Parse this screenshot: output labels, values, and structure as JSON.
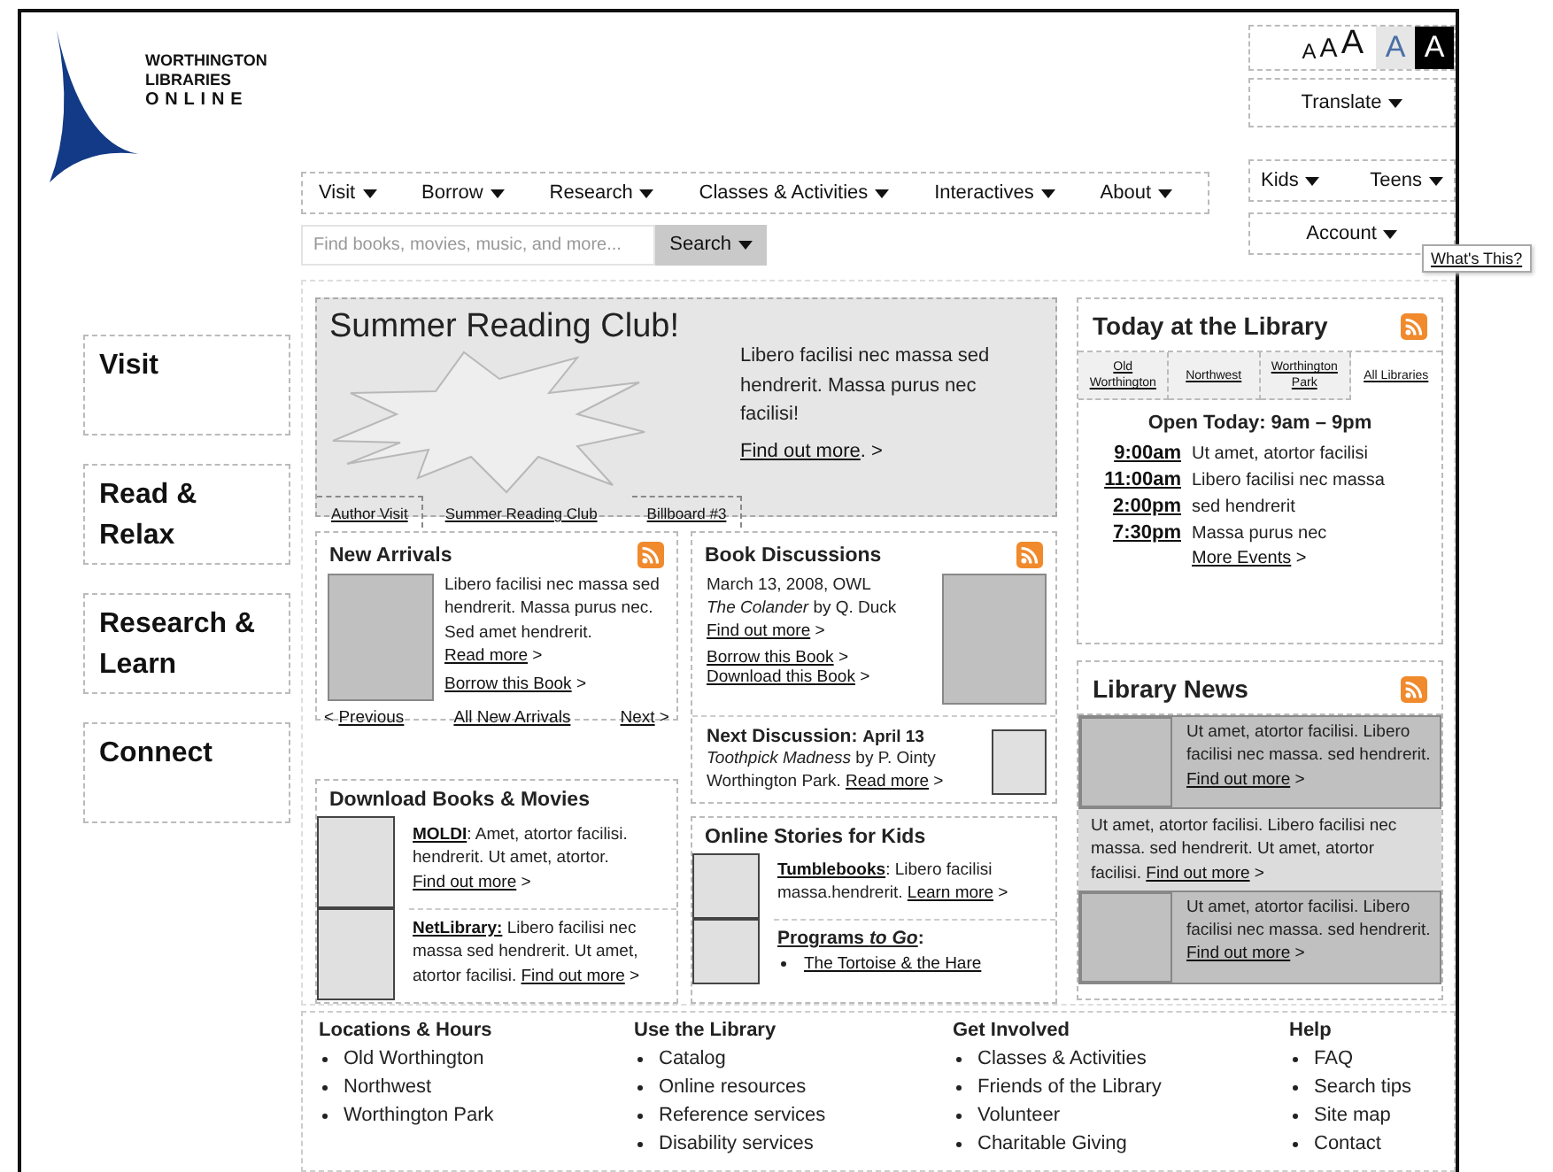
{
  "logo": {
    "lines": [
      "WORTHINGTON",
      "LIBRARIES",
      "ONLINE"
    ]
  },
  "text_size_options": [
    {
      "label": "A",
      "kind": "small"
    },
    {
      "label": "A",
      "kind": "medium"
    },
    {
      "label": "A",
      "kind": "large"
    }
  ],
  "contrast_options": [
    {
      "label": "A",
      "kind": "light"
    },
    {
      "label": "A",
      "kind": "dark"
    }
  ],
  "translate": "Translate",
  "main_nav": [
    "Visit",
    "Borrow",
    "Research",
    "Classes & Activities",
    "Interactives",
    "About"
  ],
  "audience_nav": [
    "Kids",
    "Teens"
  ],
  "search": {
    "placeholder": "Find books, movies, music, and more...",
    "button": "Search"
  },
  "account": "Account",
  "tooltip": "What's This?",
  "side_nav": [
    "Visit",
    "Read & Relax",
    "Research & Learn",
    "Connect"
  ],
  "feature": {
    "title": "Summer Reading Club!",
    "text": "Libero facilisi nec massa sed hendrerit.  Massa purus nec facilisi!",
    "link": "Find out more",
    "suffix": ". >",
    "tabs": [
      {
        "label": "Author Visit",
        "selected": false
      },
      {
        "label": "Summer Reading Club",
        "selected": true
      },
      {
        "label": "Billboard #3",
        "selected": false
      }
    ]
  },
  "new_arrivals": {
    "title": "New Arrivals",
    "text": "Libero facilisi nec massa sed hendrerit. Massa purus nec. Sed amet hendrerit.",
    "link": "Read more",
    "suffix": " >",
    "action": "Borrow this Book",
    "action_suffix": " >",
    "previous_prefix": "< ",
    "previous": "Previous",
    "all": "All New Arrivals",
    "next": "Next",
    "next_suffix": " >"
  },
  "downloads": {
    "title": "Download Books & Movies",
    "items": [
      {
        "name": "MOLDI",
        "text": ": Amet, atortor facilisi. hendrerit. Ut amet, atortor.",
        "link": "Find out more",
        "suffix": " >"
      },
      {
        "name": "NetLibrary:",
        "text": " Libero facilisi nec massa sed hendrerit. Ut amet, atortor facilisi.",
        "link": "Find out more",
        "suffix": " >"
      }
    ]
  },
  "discussions": {
    "title": "Book Discussions",
    "lines": [
      "March 13, 2008, OWL",
      "*The Colander* by Q. Duck"
    ],
    "link": "Find out more",
    "suffix": " >",
    "actions": [
      {
        "label": "Borrow this Book",
        "suffix": "      >"
      },
      {
        "label": "Download this Book",
        "suffix": " >"
      }
    ],
    "next": {
      "heading": "Next Discussion:",
      "date": "April 13",
      "line": "*Toothpick Madness* by P. Ointy",
      "text": "Worthington Park.",
      "link": "Read more",
      "suffix": " >"
    }
  },
  "kids": {
    "title": "Online Stories for Kids",
    "items": [
      {
        "kind": "blurb",
        "name": "Tumblebooks",
        "text": ":  Libero facilisi massa.hendrerit.",
        "link": "Learn more",
        "suffix": " >"
      },
      {
        "kind": "list",
        "name": "Programs *to Go*",
        "text": ":",
        "links": [
          "The Tortoise & the Hare"
        ]
      }
    ]
  },
  "today": {
    "title": "Today at the Library",
    "branches": [
      {
        "label": "Old Worthington",
        "selected": false
      },
      {
        "label": "Northwest",
        "selected": false
      },
      {
        "label": "Worthington Park",
        "selected": false
      },
      {
        "label": "All Libraries",
        "selected": true
      }
    ],
    "hours": "Open Today:  9am – 9pm",
    "events": [
      {
        "time": "9:00am",
        "title": "Ut amet, atortor facilisi"
      },
      {
        "time": "11:00am",
        "title": "Libero facilisi nec massa"
      },
      {
        "time": "2:00pm",
        "title": "sed hendrerit"
      },
      {
        "time": "7:30pm",
        "title": "Massa purus nec"
      }
    ],
    "more": "More Events",
    "more_suffix": "  >"
  },
  "news": {
    "title": "Library News",
    "items": [
      {
        "kind": "image",
        "text": "Ut amet, atortor facilisi. Libero facilisi nec massa. sed hendrerit. ",
        "link": "Find out more",
        "suffix": " >"
      },
      {
        "kind": "highlight",
        "text": "Ut amet, atortor facilisi. Libero facilisi nec massa. sed hendrerit. Ut amet, atortor facilisi. ",
        "link": "Find out more",
        "suffix": " >"
      },
      {
        "kind": "image",
        "text": "Ut amet, atortor facilisi. Libero facilisi nec massa. sed hendrerit. ",
        "link": "Find out more",
        "suffix": " >"
      }
    ]
  },
  "footer": [
    {
      "title": "Locations & Hours",
      "items": [
        "Old Worthington",
        "Northwest",
        "Worthington Park"
      ]
    },
    {
      "title": "Use the Library",
      "items": [
        "Catalog",
        "Online resources",
        "Reference services",
        "Disability services"
      ]
    },
    {
      "title": "Get Involved",
      "items": [
        "Classes & Activities",
        "Friends of the Library",
        "Volunteer",
        "Charitable Giving"
      ]
    },
    {
      "title": "Help",
      "items": [
        "FAQ",
        "Search tips",
        "Site map",
        "Contact"
      ]
    }
  ]
}
